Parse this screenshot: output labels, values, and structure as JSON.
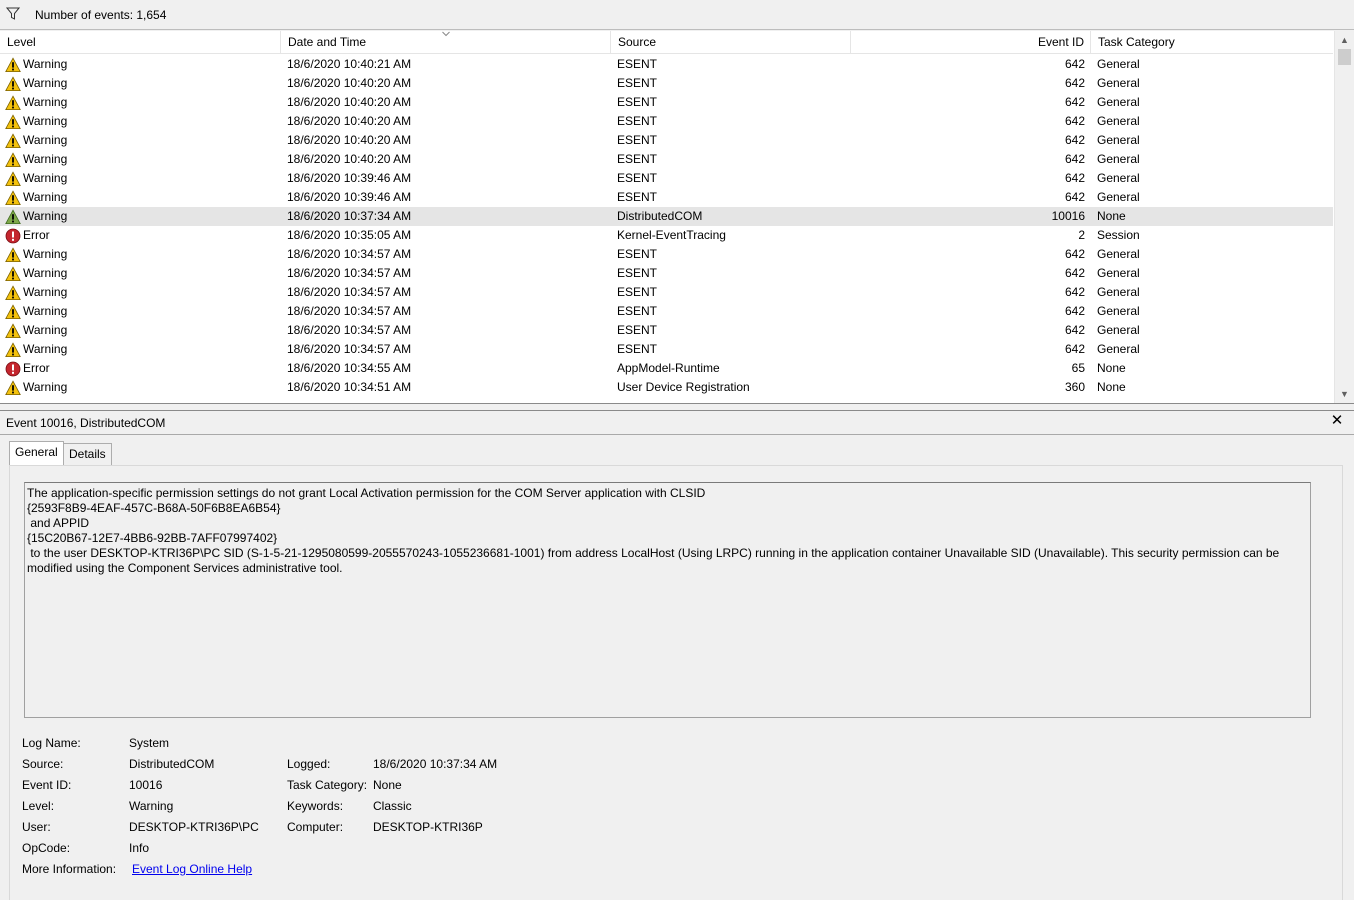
{
  "toolbar": {
    "filter_icon": "filter-funnel-icon",
    "count_text": "Number of events: 1,654"
  },
  "columns": {
    "level": "Level",
    "date_time": "Date and Time",
    "source": "Source",
    "event_id": "Event ID",
    "task_category": "Task Category"
  },
  "rows": [
    {
      "level": "Warning",
      "icon": "warning-icon",
      "date": "18/6/2020 10:40:21 AM",
      "source": "ESENT",
      "id": "642",
      "category": "General"
    },
    {
      "level": "Warning",
      "icon": "warning-icon",
      "date": "18/6/2020 10:40:20 AM",
      "source": "ESENT",
      "id": "642",
      "category": "General"
    },
    {
      "level": "Warning",
      "icon": "warning-icon",
      "date": "18/6/2020 10:40:20 AM",
      "source": "ESENT",
      "id": "642",
      "category": "General"
    },
    {
      "level": "Warning",
      "icon": "warning-icon",
      "date": "18/6/2020 10:40:20 AM",
      "source": "ESENT",
      "id": "642",
      "category": "General"
    },
    {
      "level": "Warning",
      "icon": "warning-icon",
      "date": "18/6/2020 10:40:20 AM",
      "source": "ESENT",
      "id": "642",
      "category": "General"
    },
    {
      "level": "Warning",
      "icon": "warning-icon",
      "date": "18/6/2020 10:40:20 AM",
      "source": "ESENT",
      "id": "642",
      "category": "General"
    },
    {
      "level": "Warning",
      "icon": "warning-icon",
      "date": "18/6/2020 10:39:46 AM",
      "source": "ESENT",
      "id": "642",
      "category": "General"
    },
    {
      "level": "Warning",
      "icon": "warning-icon",
      "date": "18/6/2020 10:39:46 AM",
      "source": "ESENT",
      "id": "642",
      "category": "General"
    },
    {
      "level": "Warning",
      "icon": "warning-icon",
      "date": "18/6/2020 10:37:34 AM",
      "source": "DistributedCOM",
      "id": "10016",
      "category": "None",
      "selected": true
    },
    {
      "level": "Error",
      "icon": "error-icon",
      "date": "18/6/2020 10:35:05 AM",
      "source": "Kernel-EventTracing",
      "id": "2",
      "category": "Session"
    },
    {
      "level": "Warning",
      "icon": "warning-icon",
      "date": "18/6/2020 10:34:57 AM",
      "source": "ESENT",
      "id": "642",
      "category": "General"
    },
    {
      "level": "Warning",
      "icon": "warning-icon",
      "date": "18/6/2020 10:34:57 AM",
      "source": "ESENT",
      "id": "642",
      "category": "General"
    },
    {
      "level": "Warning",
      "icon": "warning-icon",
      "date": "18/6/2020 10:34:57 AM",
      "source": "ESENT",
      "id": "642",
      "category": "General"
    },
    {
      "level": "Warning",
      "icon": "warning-icon",
      "date": "18/6/2020 10:34:57 AM",
      "source": "ESENT",
      "id": "642",
      "category": "General"
    },
    {
      "level": "Warning",
      "icon": "warning-icon",
      "date": "18/6/2020 10:34:57 AM",
      "source": "ESENT",
      "id": "642",
      "category": "General"
    },
    {
      "level": "Warning",
      "icon": "warning-icon",
      "date": "18/6/2020 10:34:57 AM",
      "source": "ESENT",
      "id": "642",
      "category": "General"
    },
    {
      "level": "Error",
      "icon": "error-icon",
      "date": "18/6/2020 10:34:55 AM",
      "source": "AppModel-Runtime",
      "id": "65",
      "category": "None"
    },
    {
      "level": "Warning",
      "icon": "warning-icon",
      "date": "18/6/2020 10:34:51 AM",
      "source": "User Device Registration",
      "id": "360",
      "category": "None"
    }
  ],
  "detail": {
    "title": "Event 10016, DistributedCOM",
    "tabs": [
      "General",
      "Details"
    ],
    "message": "The application-specific permission settings do not grant Local Activation permission for the COM Server application with CLSID\n{2593F8B9-4EAF-457C-B68A-50F6B8EA6B54}\n and APPID\n{15C20B67-12E7-4BB6-92BB-7AFF07997402}\n to the user DESKTOP-KTRI36P\\PC SID (S-1-5-21-1295080599-2055570243-1055236681-1001) from address LocalHost (Using LRPC) running in the application container Unavailable SID (Unavailable). This security permission can be modified using the Component Services administrative tool.",
    "labels": {
      "log_name": "Log Name:",
      "source": "Source:",
      "event_id": "Event ID:",
      "level": "Level:",
      "user": "User:",
      "opcode": "OpCode:",
      "more_info": "More Information:",
      "logged": "Logged:",
      "task_category": "Task Category:",
      "keywords": "Keywords:",
      "computer": "Computer:"
    },
    "values": {
      "log_name": "System",
      "source": "DistributedCOM",
      "event_id": "10016",
      "level": "Warning",
      "user": "DESKTOP-KTRI36P\\PC",
      "opcode": "Info",
      "more_info_link": "Event Log Online Help",
      "logged": "18/6/2020 10:37:34 AM",
      "task_category": "None",
      "keywords": "Classic",
      "computer": "DESKTOP-KTRI36P"
    }
  },
  "colors": {
    "warning": "#f4c20d",
    "error": "#c4262e",
    "selection": "#e5e5e5",
    "link": "#0000ee"
  }
}
